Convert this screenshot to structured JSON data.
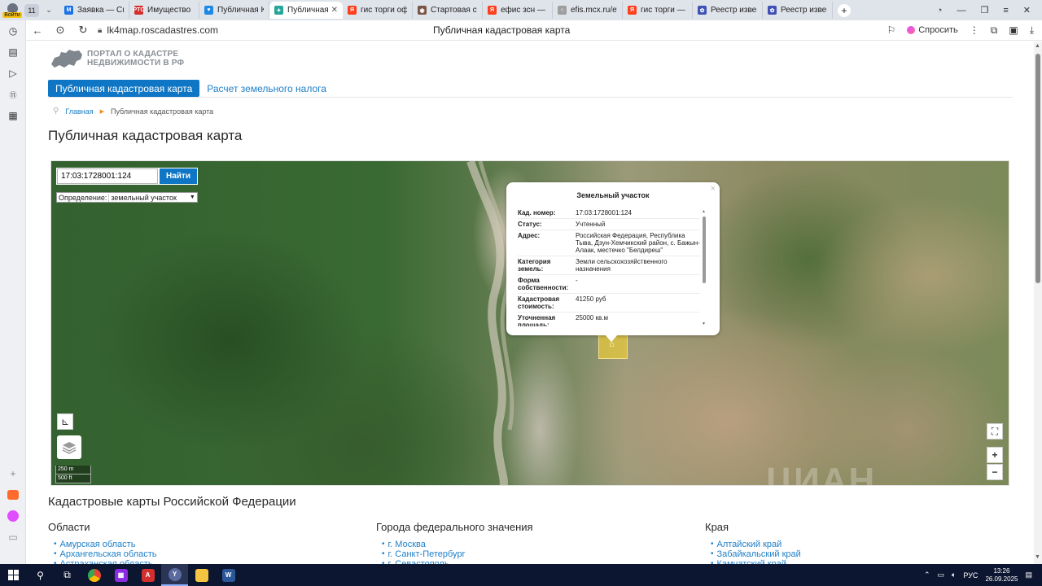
{
  "browser": {
    "profile_label": "Войти",
    "tab_count": "11",
    "tabs": [
      {
        "title": "Заявка — Спи",
        "fav": "M",
        "color": "#1a73e8"
      },
      {
        "title": "Имущество",
        "fav": "РТС",
        "color": "#d32f2f"
      },
      {
        "title": "Публичная Ка",
        "fav": "♥",
        "color": "#1e88e5"
      },
      {
        "title": "Публичная",
        "fav": "✦",
        "color": "#26a69a"
      },
      {
        "title": "гис торги офи",
        "fav": "Я",
        "color": "#fc3f1d"
      },
      {
        "title": "Стартовая стр",
        "fav": "◉",
        "color": "#795548"
      },
      {
        "title": "ефис зсн — Ян",
        "fav": "Я",
        "color": "#fc3f1d"
      },
      {
        "title": "efis.mcx.ru/efi",
        "fav": "○",
        "color": "#9e9e9e"
      },
      {
        "title": "гис торги — Ян",
        "fav": "Я",
        "color": "#fc3f1d"
      },
      {
        "title": "Реестр извеще",
        "fav": "✿",
        "color": "#3f51b5"
      },
      {
        "title": "Реестр извещ",
        "fav": "✿",
        "color": "#3f51b5"
      }
    ],
    "url": "lk4map.roscadastres.com",
    "page_title": "Публичная кадастровая карта",
    "ask_label": "Спросить"
  },
  "site": {
    "logo_line1": "ПОРТАЛ О КАДАСТРЕ",
    "logo_line2": "НЕДВИЖИМОСТИ В РФ",
    "nav_active": "Публичная кадастровая карта",
    "nav_link": "Расчет земельного налога",
    "crumb_home": "Главная",
    "crumb_current": "Публичная кадастровая карта",
    "heading": "Публичная кадастровая карта"
  },
  "map": {
    "search_value": "17:03:1728001:124",
    "search_button": "Найти",
    "def_label": "Определение:",
    "def_value": "земельный участок",
    "scale_m": "250 m",
    "scale_ft": "500 ft",
    "watermark": "ЦИАН",
    "popup": {
      "title": "Земельный участок",
      "rows": [
        {
          "k": "Кад. номер:",
          "v": "17:03:1728001:124"
        },
        {
          "k": "Статус:",
          "v": "Учтенный"
        },
        {
          "k": "Адрес:",
          "v": "Российская Федерация, Республика Тыва, Дзун-Хемчикский район, с. Бажын-Алаак, местечко \"Белдиреш\""
        },
        {
          "k": "Категория земель:",
          "v": "Земли сельскохозяйственного назначения"
        },
        {
          "k": "Форма собственности:",
          "v": "-"
        },
        {
          "k": "Кадастровая стоимость:",
          "v": "41250 руб"
        },
        {
          "k": "Уточненная площадь:",
          "v": "25000 кв.м"
        }
      ]
    }
  },
  "regions": {
    "heading": "Кадастровые карты Российской Федерации",
    "columns": [
      {
        "title": "Области",
        "items": [
          "Амурская область",
          "Архангельская область",
          "Астраханская область"
        ]
      },
      {
        "title": "Города федерального значения",
        "items": [
          "г. Москва",
          "г. Санкт-Петербург",
          "г. Севастополь"
        ]
      },
      {
        "title": "Края",
        "items": [
          "Алтайский край",
          "Забайкальский край",
          "Камчатский край"
        ]
      }
    ]
  },
  "taskbar": {
    "lang": "РУС",
    "time": "13:26",
    "date": "26.09.2025"
  }
}
